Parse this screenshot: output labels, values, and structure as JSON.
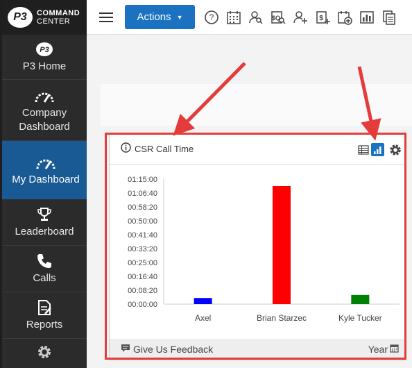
{
  "app": {
    "logo_badge": "P3",
    "logo_line1": "COMMAND",
    "logo_line2": "CENTER"
  },
  "sidebar": {
    "items": [
      {
        "label": "P3 Home",
        "icon": "p3-logo-icon"
      },
      {
        "label": "Company Dashboard",
        "icon": "gauge-icon"
      },
      {
        "label": "My Dashboard",
        "icon": "gauge-icon",
        "active": true
      },
      {
        "label": "Leaderboard",
        "icon": "trophy-icon"
      },
      {
        "label": "Calls",
        "icon": "phone-icon"
      },
      {
        "label": "Reports",
        "icon": "report-icon"
      },
      {
        "label": "",
        "icon": "gear-icon"
      }
    ]
  },
  "topbar": {
    "actions_label": "Actions",
    "icons": [
      "help-icon",
      "calendar-grid-icon",
      "user-search-icon",
      "sq-search-icon",
      "add-user-icon",
      "add-money-icon",
      "calendar-add-icon",
      "bar-report-icon",
      "documents-icon"
    ]
  },
  "widget": {
    "title": "CSR Call Time",
    "feedback_label": "Give Us Feedback",
    "period_label": "Year",
    "colors": {
      "accent": "#1a72c0",
      "highlight": "#e53b3b"
    }
  },
  "chart_data": {
    "type": "bar",
    "categories": [
      "Axel",
      "Brian Starzec",
      "Kyle Tucker"
    ],
    "values_seconds": [
      220,
      4250,
      330
    ],
    "values": [
      "00:03:40",
      "01:10:50",
      "00:05:30"
    ],
    "colors": [
      "#0000ff",
      "#ff0000",
      "#008000"
    ],
    "y_ticks": [
      "00:00:00",
      "00:08:20",
      "00:16:40",
      "00:25:00",
      "00:33:20",
      "00:41:40",
      "00:50:00",
      "00:58:20",
      "01:06:40",
      "01:15:00"
    ],
    "ylim_seconds": [
      0,
      4500
    ]
  }
}
